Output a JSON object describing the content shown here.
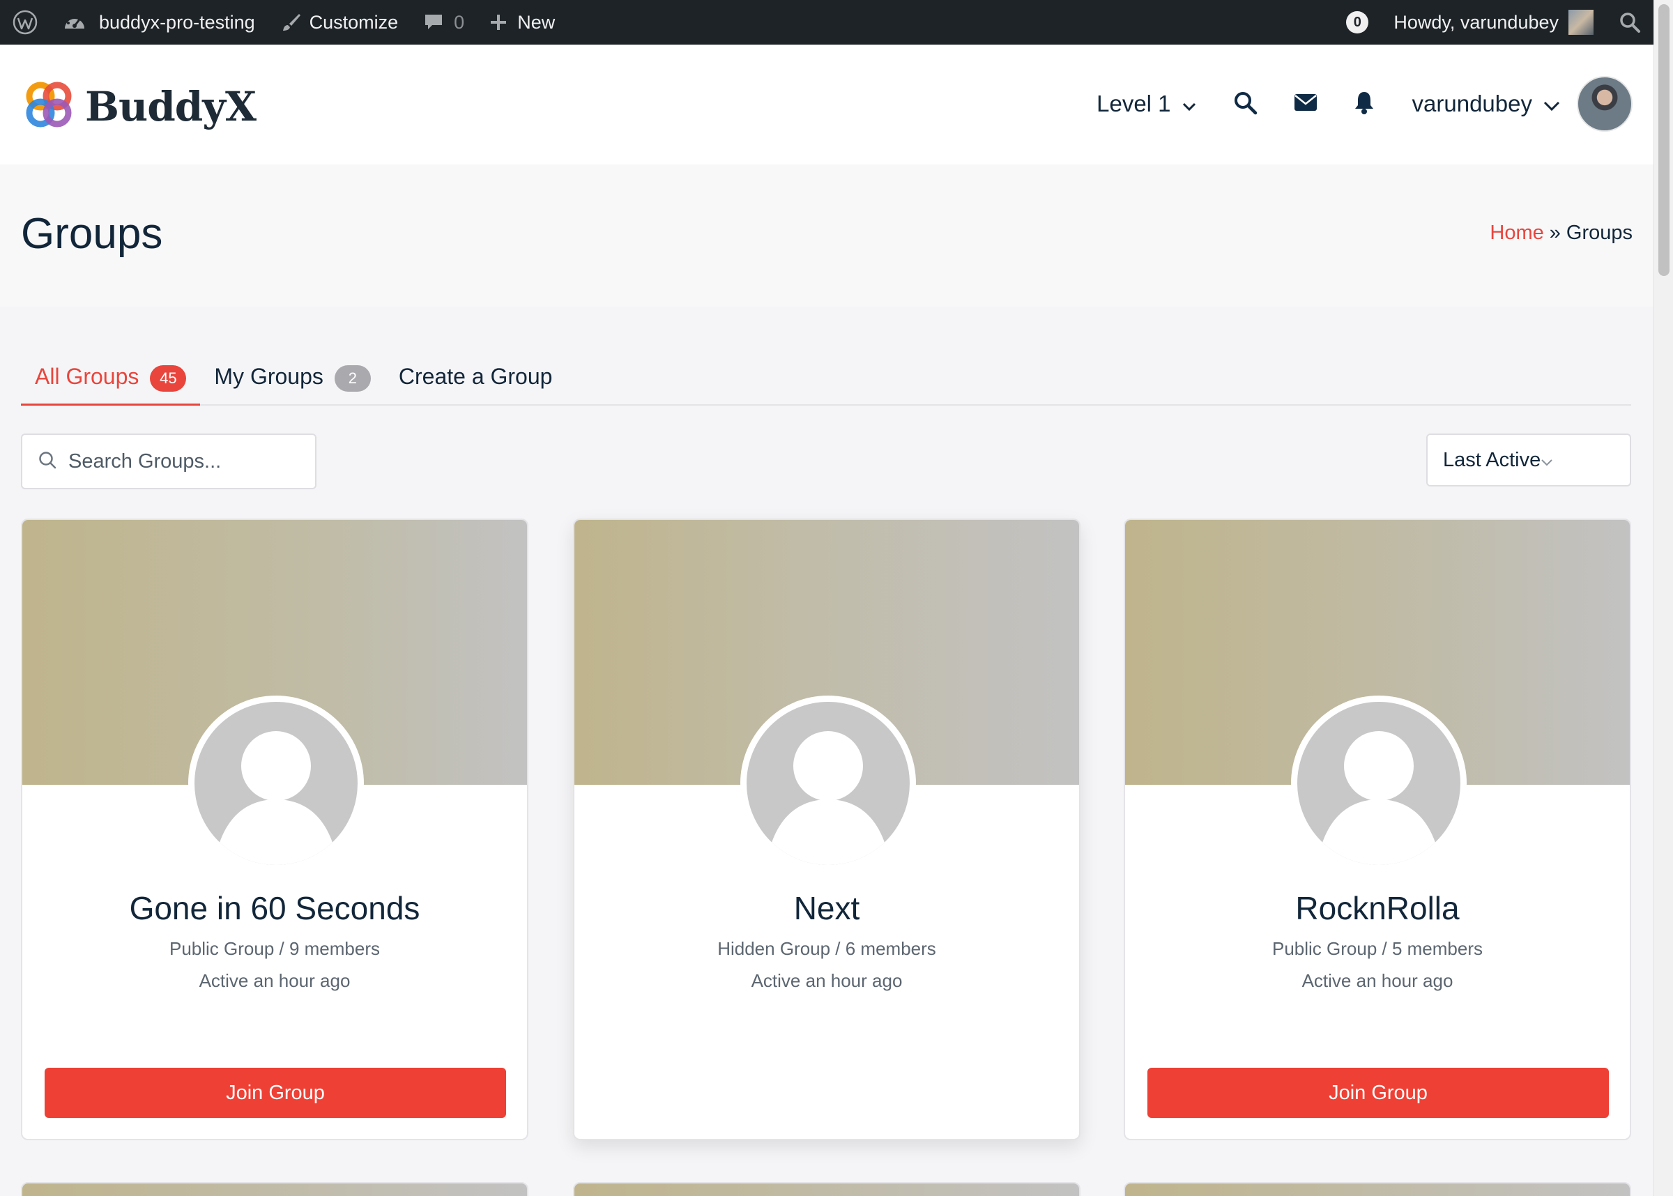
{
  "admin_bar": {
    "site_name": "buddyx-pro-testing",
    "customize": "Customize",
    "comments_count": "0",
    "new_label": "New",
    "notifications_count": "0",
    "howdy": "Howdy, varundubey",
    "icons": [
      "wordpress-icon",
      "dashboard-icon",
      "brush-icon",
      "comment-icon",
      "plus-icon",
      "search-icon"
    ]
  },
  "header": {
    "logo_text": "BuddyX",
    "level_menu": "Level 1",
    "username": "varundubey",
    "icons": [
      "search-icon",
      "envelope-icon",
      "bell-icon",
      "chevron-down-icon"
    ]
  },
  "page": {
    "title": "Groups",
    "breadcrumb": {
      "home": "Home",
      "separator": "»",
      "current": "Groups"
    }
  },
  "tabs": [
    {
      "label": "All Groups",
      "count": "45",
      "active": true
    },
    {
      "label": "My Groups",
      "count": "2",
      "active": false
    },
    {
      "label": "Create a Group",
      "count": null,
      "active": false
    }
  ],
  "search": {
    "placeholder": "Search Groups..."
  },
  "sort": {
    "selected": "Last Active"
  },
  "groups": [
    {
      "name": "Gone in 60 Seconds",
      "meta": "Public Group / 9 members",
      "activity": "Active an hour ago",
      "button": "Join Group"
    },
    {
      "name": "Next",
      "meta": "Hidden Group / 6 members",
      "activity": "Active an hour ago",
      "button": null
    },
    {
      "name": "RocknRolla",
      "meta": "Public Group / 5 members",
      "activity": "Active an hour ago",
      "button": "Join Group"
    }
  ],
  "colors": {
    "accent": "#e9453c",
    "button": "#ee4035",
    "admin_bar": "#1d2327",
    "text": "#12263a",
    "cover_gradient_start": "#bfb48c",
    "cover_gradient_end": "#c2c2c2"
  }
}
